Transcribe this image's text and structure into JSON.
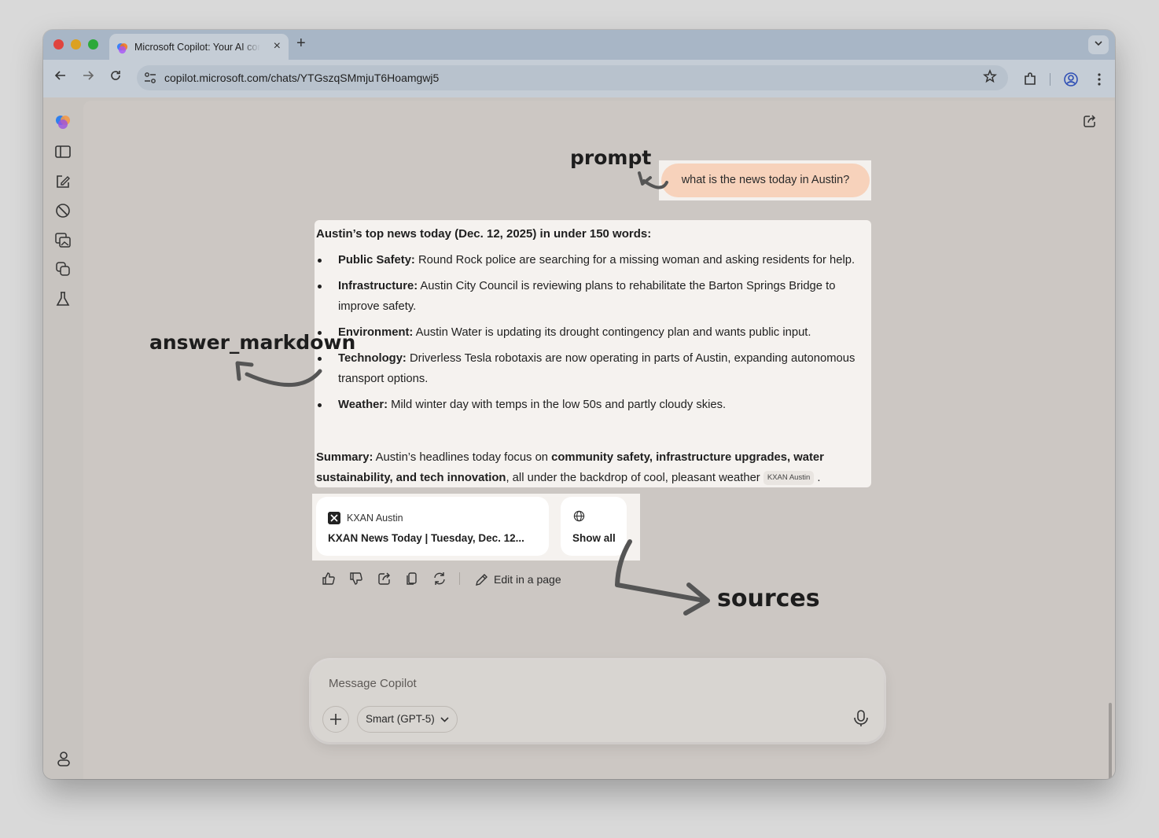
{
  "browser": {
    "tab_title": "Microsoft Copilot: Your AI companion",
    "new_tab_symbol": "+",
    "close_symbol": "×",
    "url": "copilot.microsoft.com/chats/YTGszqSMmjuT6Hoamgwj5"
  },
  "chat": {
    "prompt": "what is the news today in Austin?",
    "answer": {
      "title": "Austin’s top news today (Dec. 12, 2025) in under 150 words:",
      "items": [
        {
          "label": "Public Safety:",
          "text": " Round Rock police are searching for a missing woman and asking residents for help."
        },
        {
          "label": "Infrastructure:",
          "text": " Austin City Council is reviewing plans to rehabilitate the Barton Springs Bridge to improve safety."
        },
        {
          "label": "Environment:",
          "text": " Austin Water is updating its drought contingency plan and wants public input."
        },
        {
          "label": "Technology:",
          "text": " Driverless Tesla robotaxis are now operating in parts of Austin, expanding autonomous transport options."
        },
        {
          "label": "Weather:",
          "text": " Mild winter day with temps in the low 50s and partly cloudy skies."
        }
      ],
      "summary_label": "Summary:",
      "summary_pre": " Austin’s headlines today focus on ",
      "summary_bold": "community safety, infrastructure upgrades, water sustainability, and tech innovation",
      "summary_post": ", all under the backdrop of cool, pleasant weather",
      "citation_chip": "KXAN Austin",
      "summary_end": " ."
    },
    "sources": {
      "card": {
        "name": "KXAN Austin",
        "headline": "KXAN News Today | Tuesday, Dec. 12..."
      },
      "show_all": "Show all"
    },
    "actions": {
      "edit_in_page": "Edit in a page"
    },
    "composer": {
      "placeholder": "Message Copilot",
      "model": "Smart (GPT-5)"
    }
  },
  "annotations": {
    "prompt": "prompt",
    "answer": "answer_markdown",
    "sources": "sources"
  },
  "colors": {
    "prompt_bubble": "#f7d2bb",
    "tab_strip": "#a8b6c6",
    "page_background": "#ccc7c3",
    "annotation_arrow": "#555555"
  }
}
